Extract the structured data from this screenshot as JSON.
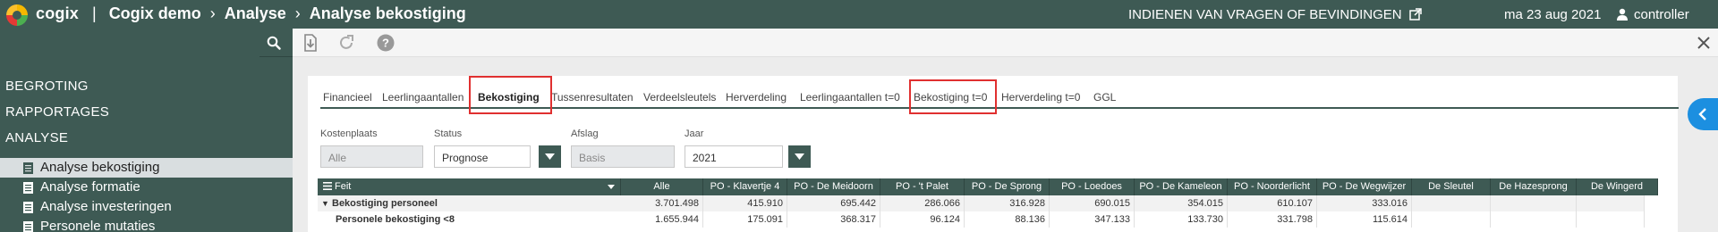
{
  "header": {
    "brand": "cogix",
    "crumbs": [
      "Cogix demo",
      "Analyse",
      "Analyse bekostiging"
    ],
    "feedback_link": "INDIENEN VAN VRAGEN OF BEVINDINGEN",
    "date": "ma 23 aug 2021",
    "user": "controller"
  },
  "sidebar": {
    "sections": [
      "BEGROTING",
      "RAPPORTAGES",
      "ANALYSE"
    ],
    "items": [
      {
        "label": "Analyse bekostiging",
        "active": true
      },
      {
        "label": "Analyse formatie",
        "active": false
      },
      {
        "label": "Analyse investeringen",
        "active": false
      },
      {
        "label": "Personele mutaties",
        "active": false
      }
    ]
  },
  "tabs": [
    "Financieel",
    "Leerlingaantallen",
    "Bekostiging",
    "Tussenresultaten",
    "Verdeelsleutels",
    "Herverdeling",
    "Leerlingaantallen t=0",
    "Bekostiging t=0",
    "Herverdeling t=0",
    "GGL"
  ],
  "active_tab": "Bekostiging",
  "filters": {
    "kostenplaats": {
      "label": "Kostenplaats",
      "value": "Alle"
    },
    "status": {
      "label": "Status",
      "value": "Prognose"
    },
    "afslag": {
      "label": "Afslag",
      "value": "Basis"
    },
    "jaar": {
      "label": "Jaar",
      "value": "2021"
    }
  },
  "table": {
    "feit_header": "Feit",
    "columns": [
      "Alle",
      "PO - Klavertje 4",
      "PO - De Meidoorn",
      "PO - 't Palet",
      "PO - De Sprong",
      "PO - Loedoes",
      "PO - De Kameleon",
      "PO - Noorderlicht",
      "PO - De Wegwijzer",
      "De Sleutel",
      "De Hazesprong",
      "De Wingerd"
    ],
    "rows": [
      {
        "feit": "Bekostiging personeel",
        "values": [
          "3.701.498",
          "415.910",
          "695.442",
          "286.066",
          "316.928",
          "690.015",
          "354.015",
          "610.107",
          "333.016",
          "",
          "",
          ""
        ]
      },
      {
        "feit": "Personele bekostiging <8",
        "values": [
          "1.655.944",
          "175.091",
          "368.317",
          "96.124",
          "88.136",
          "347.133",
          "133.730",
          "331.798",
          "115.614",
          "",
          "",
          ""
        ]
      }
    ]
  },
  "colors": {
    "primary": "#3e5a54",
    "highlight": "#e03030",
    "accent": "#1c8fe0"
  }
}
